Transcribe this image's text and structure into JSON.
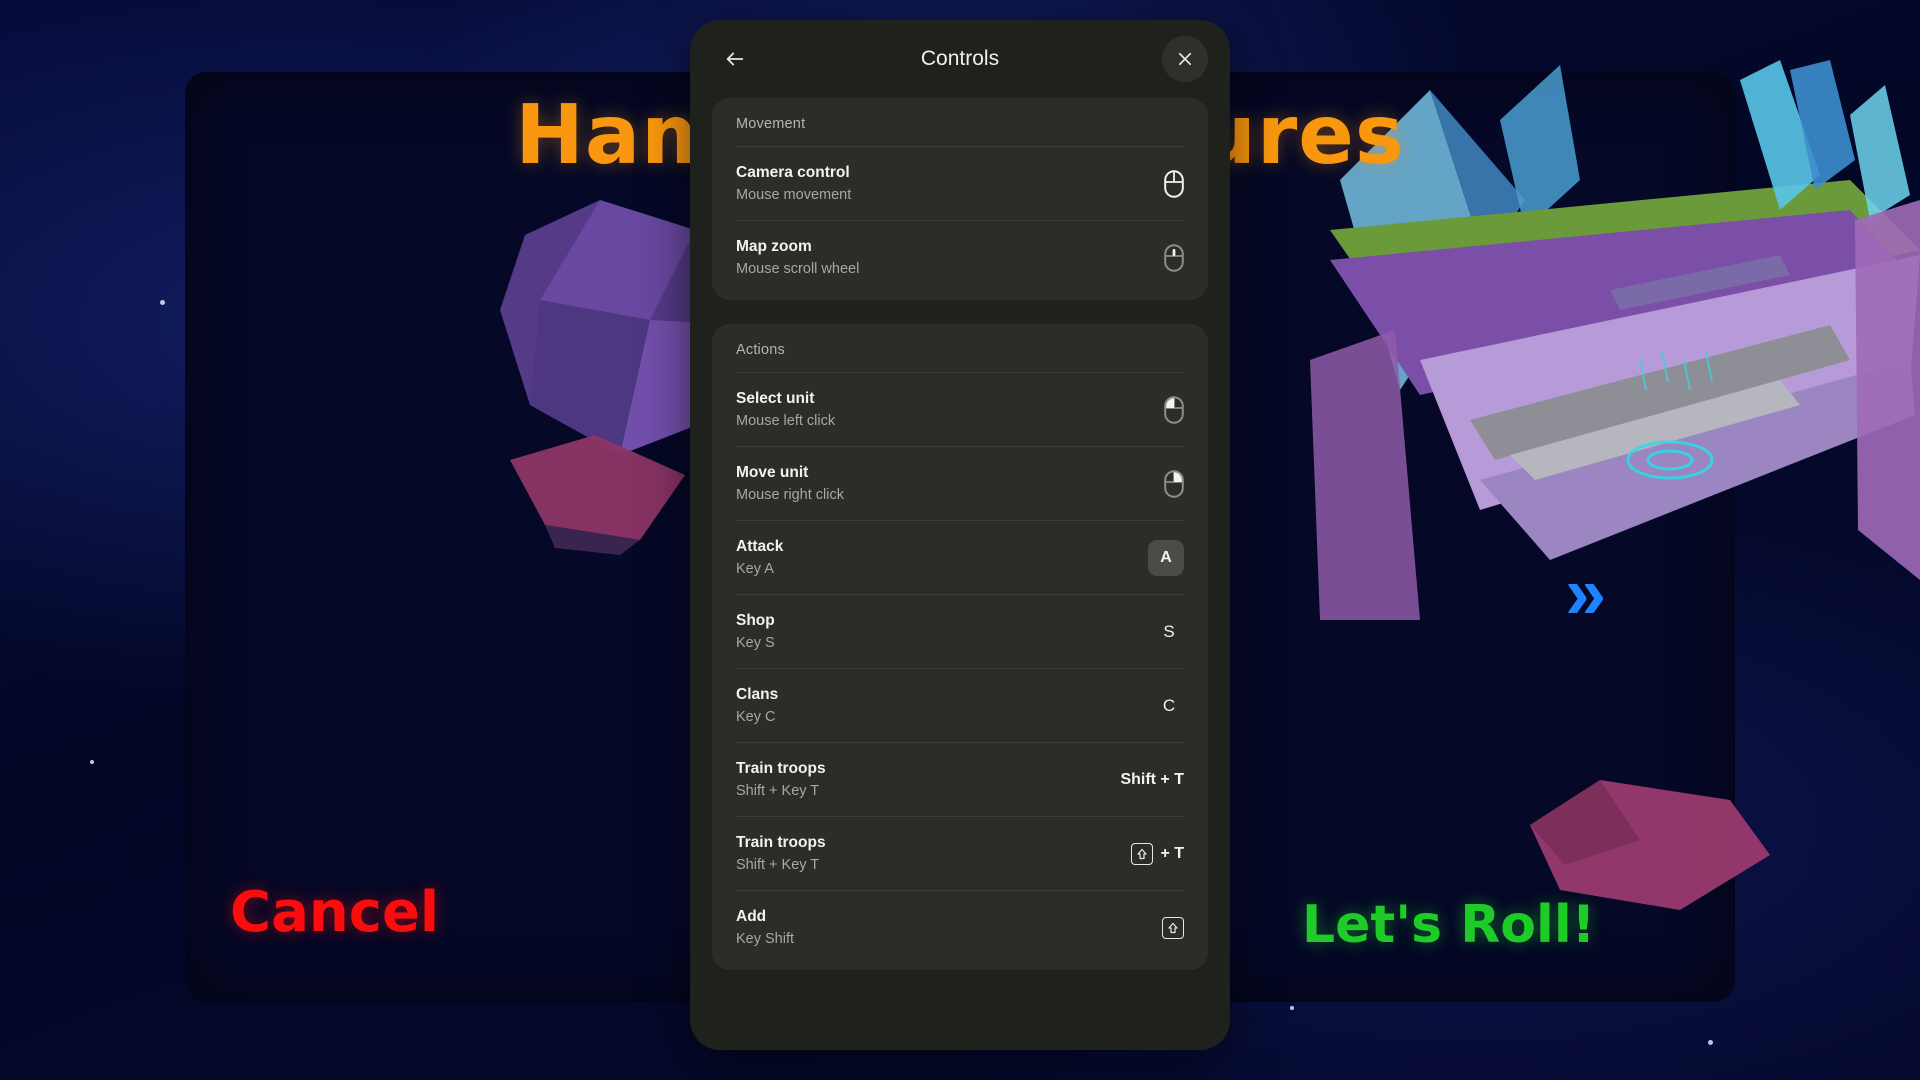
{
  "game": {
    "title": "Hammer Creatures",
    "cancel_label": "Cancel",
    "confirm_label": "Let's Roll!",
    "chevrons": "»",
    "colors": {
      "title": "#f9970f",
      "cancel": "#fb0d0d",
      "confirm": "#1ecb28",
      "chevron": "#1f83ff",
      "space_bg": "#050a33"
    }
  },
  "dialog": {
    "title": "Controls",
    "back_icon": "arrow-left-icon",
    "close_icon": "close-icon",
    "accent": "#2b2d28",
    "sections": [
      {
        "title": "Movement",
        "rows": [
          {
            "label": "Camera control",
            "sub": "Mouse movement",
            "binding_type": "mouse",
            "icon": "mouse-move-icon",
            "binding_text": ""
          },
          {
            "label": "Map zoom",
            "sub": "Mouse scroll wheel",
            "binding_type": "mouse",
            "icon": "mouse-scroll-icon",
            "binding_text": ""
          }
        ]
      },
      {
        "title": "Actions",
        "rows": [
          {
            "label": "Select unit",
            "sub": "Mouse left click",
            "binding_type": "mouse",
            "icon": "mouse-left-click-icon",
            "binding_text": ""
          },
          {
            "label": "Move unit",
            "sub": "Mouse right click",
            "binding_type": "mouse",
            "icon": "mouse-right-click-icon",
            "binding_text": ""
          },
          {
            "label": "Attack",
            "sub": "Key A",
            "binding_type": "chip",
            "icon": "",
            "binding_text": "A"
          },
          {
            "label": "Shop",
            "sub": "Key S",
            "binding_type": "plain",
            "icon": "",
            "binding_text": "S"
          },
          {
            "label": "Clans",
            "sub": "Key C",
            "binding_type": "plain",
            "icon": "",
            "binding_text": "C"
          },
          {
            "label": "Train troops",
            "sub": "Shift + Key T",
            "binding_type": "text",
            "icon": "",
            "binding_text": "Shift + T"
          },
          {
            "label": "Train troops",
            "sub": "Shift + Key T",
            "binding_type": "shift_plus",
            "icon": "shift-key-icon",
            "binding_text": "+ T"
          },
          {
            "label": "Add",
            "sub": "Key Shift",
            "binding_type": "shift_only",
            "icon": "shift-key-icon",
            "binding_text": ""
          }
        ]
      }
    ]
  }
}
